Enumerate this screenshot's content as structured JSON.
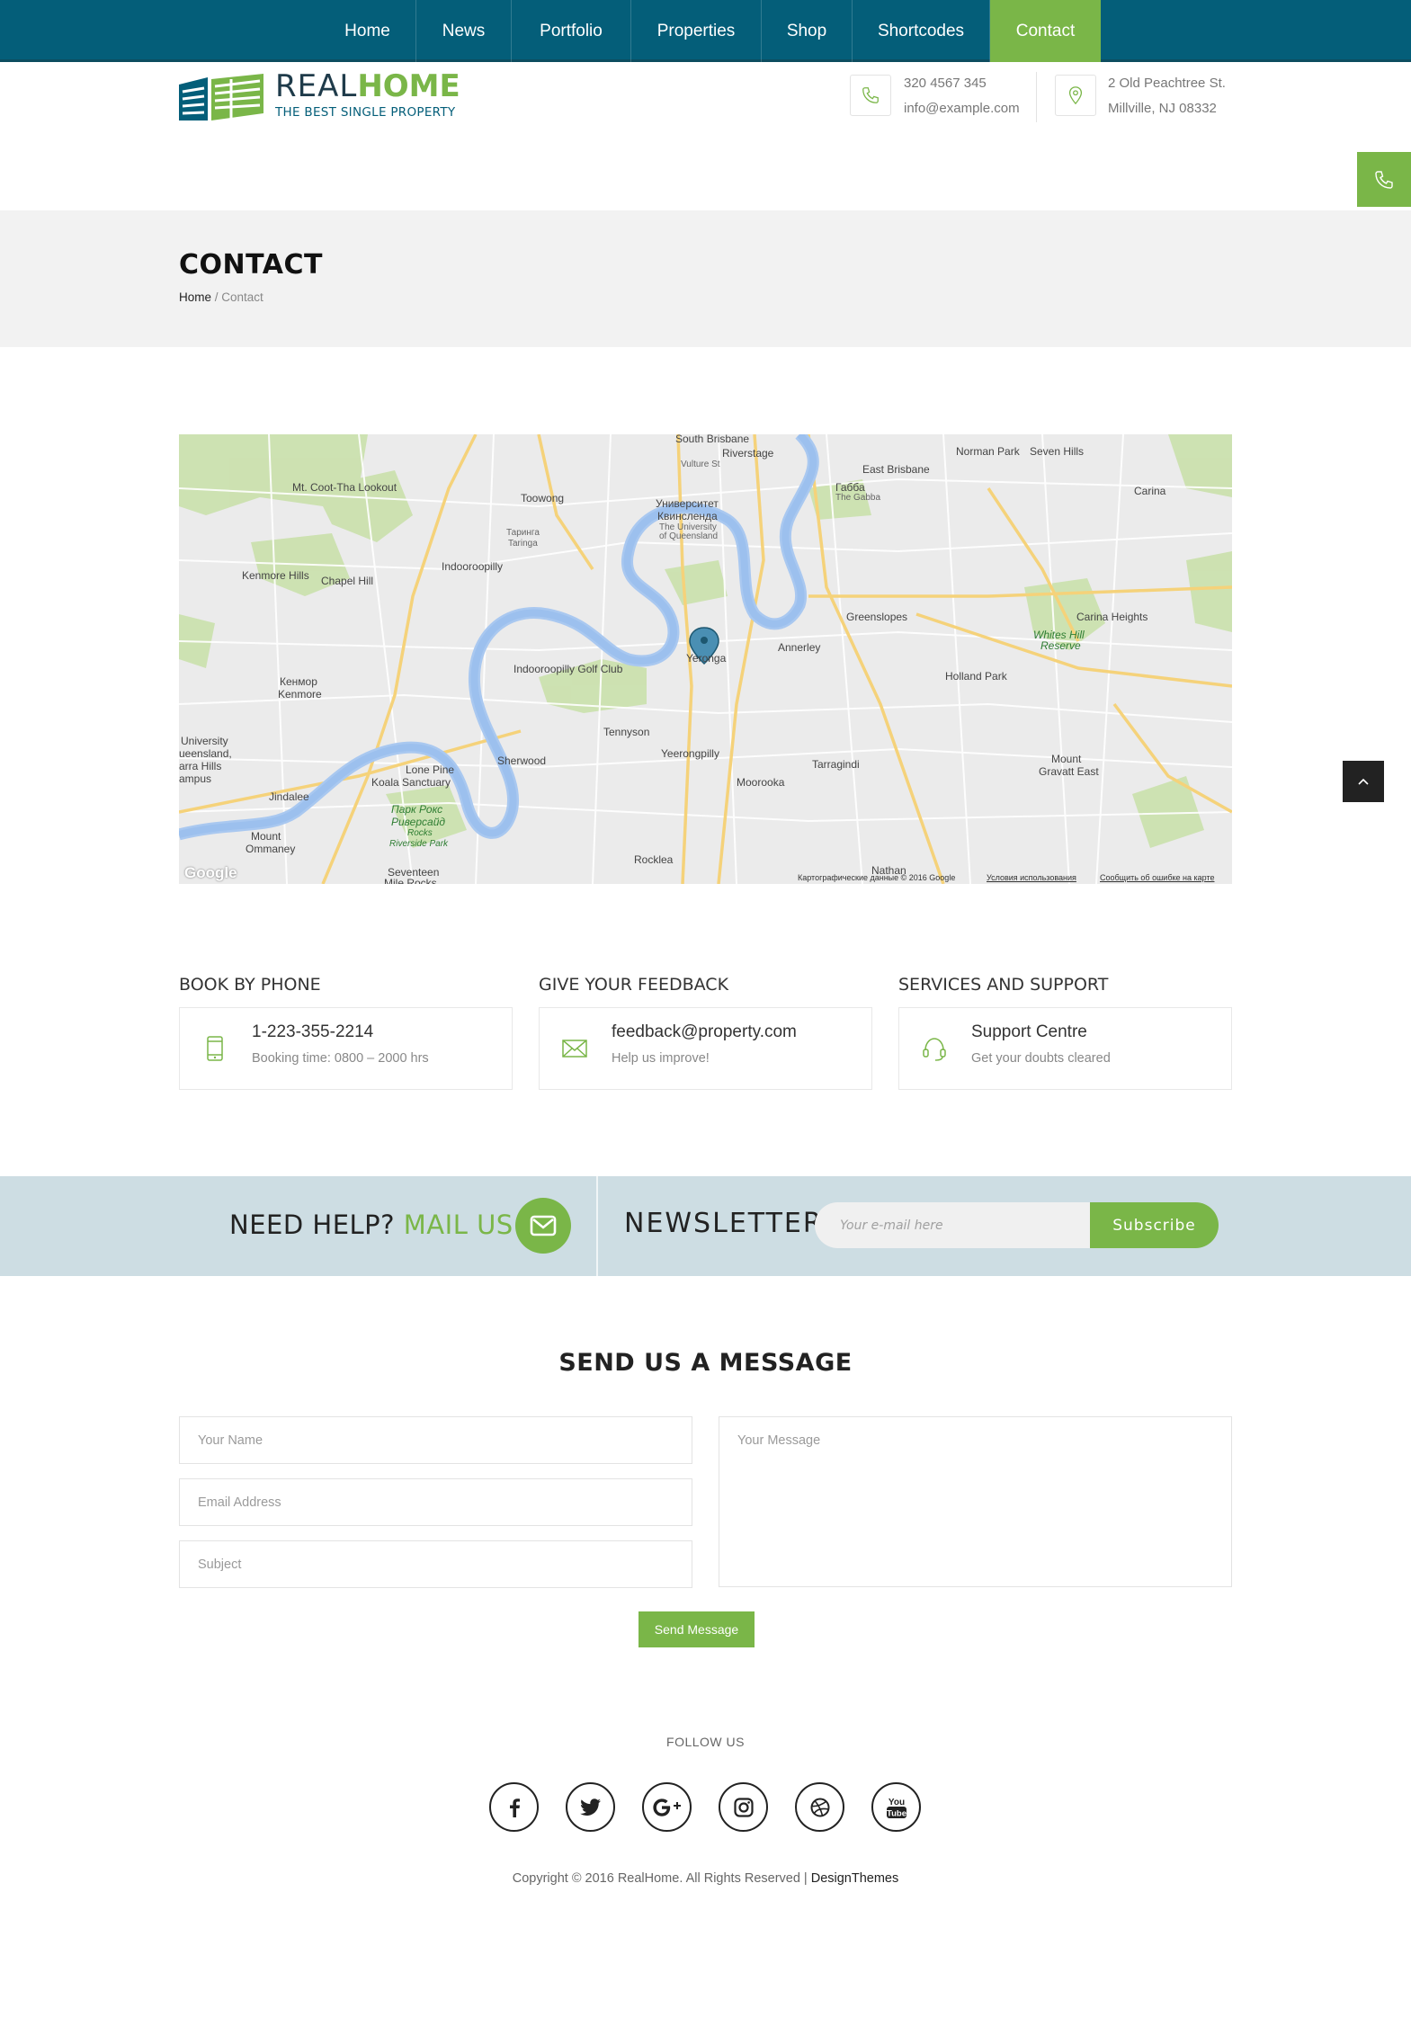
{
  "nav": {
    "items": [
      {
        "label": "Home"
      },
      {
        "label": "News"
      },
      {
        "label": "Portfolio"
      },
      {
        "label": "Properties"
      },
      {
        "label": "Shop"
      },
      {
        "label": "Shortcodes"
      },
      {
        "label": "Contact",
        "active": true
      }
    ]
  },
  "header": {
    "logo_part1": "REAL",
    "logo_part2": "HOME",
    "logo_tagline": "THE BEST SINGLE PROPERTY",
    "phone": "320 4567 345",
    "email": "info@example.com",
    "address_line1": "2 Old Peachtree St.",
    "address_line2": "Millville, NJ 08332"
  },
  "page": {
    "title": "CONTACT",
    "breadcrumb_home": "Home",
    "breadcrumb_sep": " / ",
    "breadcrumb_current": "Contact"
  },
  "map": {
    "labels": {
      "mt_coot": "Mt. Coot-Tha Lookout",
      "toowong": "Toowong",
      "taringa": "Таринга",
      "taringa_en": "Taringa",
      "indooroopilly": "Indooroopilly",
      "kenmore_hills": "Kenmore Hills",
      "chapel_hill": "Chapel Hill",
      "kenmore_ru": "Кенмор",
      "kenmore": "Kenmore",
      "university_ru": "Университет",
      "university_ru2": "Квинсленда",
      "university_en": "The University",
      "university_en2": "of Queensland",
      "south_brisbane": "South Brisbane",
      "riverstage": "Riverstage",
      "vulture_st": "Vulture St",
      "east_brisbane": "East Brisbane",
      "norman_park": "Norman Park",
      "seven_hills": "Seven Hills",
      "gabba_ru": "Габба",
      "gabba": "The Gabba",
      "carina": "Carina",
      "greenslopes": "Greenslopes",
      "annerley": "Annerley",
      "yeronga": "Yeronga",
      "golf_club": "Indooroopilly Golf Club",
      "tennyson": "Tennyson",
      "yeerongpilly": "Yeerongpilly",
      "moorooka": "Moorooka",
      "tarragindi": "Tarragindi",
      "holland_park": "Holland Park",
      "carina_heights": "Carina Heights",
      "whites_hill": "Whites Hill",
      "reserve": "Reserve",
      "mount_gravatt": "Mount",
      "mount_gravatt2": "Gravatt East",
      "sherwood": "Sherwood",
      "lone_pine": "Lone Pine",
      "koala": "Koala Sanctuary",
      "park_rocks_ru": "Парк Рокс",
      "park_rocks_ru2": "Риверсайд",
      "park_rocks": "Rocks",
      "riverside_park": "Riverside Park",
      "jindalee": "Jindalee",
      "mount_ommaney": "Mount",
      "mount_ommaney2": "Ommaney",
      "uni_qld_campus1": "University",
      "uni_qld_campus2": "ueensland,",
      "uni_qld_campus3": "arra Hills",
      "uni_qld_campus4": "ampus",
      "seventeen_mile": "Seventeen",
      "seventeen_mile2": "Mile Rocks",
      "rocklea": "Rocklea",
      "nathan": "Nathan",
      "google": "Google",
      "footer_data": "Картографические данные © 2016 Google",
      "footer_terms": "Условия использования",
      "footer_report": "Сообщить об ошибке на карте"
    }
  },
  "cards": [
    {
      "heading": "BOOK BY PHONE",
      "main": "1-223-355-2214",
      "sub": "Booking time: 0800 – 2000 hrs",
      "icon": "mobile-icon"
    },
    {
      "heading": "GIVE YOUR FEEDBACK",
      "main": "feedback@property.com",
      "sub": "Help us improve!",
      "icon": "envelope-icon"
    },
    {
      "heading": "SERVICES AND SUPPORT",
      "main": "Support Centre",
      "sub": "Get your doubts cleared",
      "icon": "headset-icon"
    }
  ],
  "newsletter": {
    "help_prefix": "NEED HELP?",
    "help_highlight": "MAIL US",
    "title": "NEWSLETTER",
    "input_placeholder": "Your e-mail here",
    "button_label": "Subscribe"
  },
  "form": {
    "title": "SEND US A MESSAGE",
    "name_placeholder": "Your Name",
    "email_placeholder": "Email Address",
    "subject_placeholder": "Subject",
    "message_placeholder": "Your Message",
    "send_label": "Send Message"
  },
  "footer": {
    "follow_label": "FOLLOW US",
    "socials": [
      "facebook-icon",
      "twitter-icon",
      "google-plus-icon",
      "instagram-icon",
      "dribbble-icon",
      "youtube-icon"
    ],
    "copyright": "Copyright © 2016 RealHome. All Rights Reserved | ",
    "brand": "DesignThemes"
  },
  "colors": {
    "nav_bg": "#045e79",
    "accent": "#7ab648",
    "band_bg": "#cddde3",
    "title_band": "#f2f2f2"
  }
}
